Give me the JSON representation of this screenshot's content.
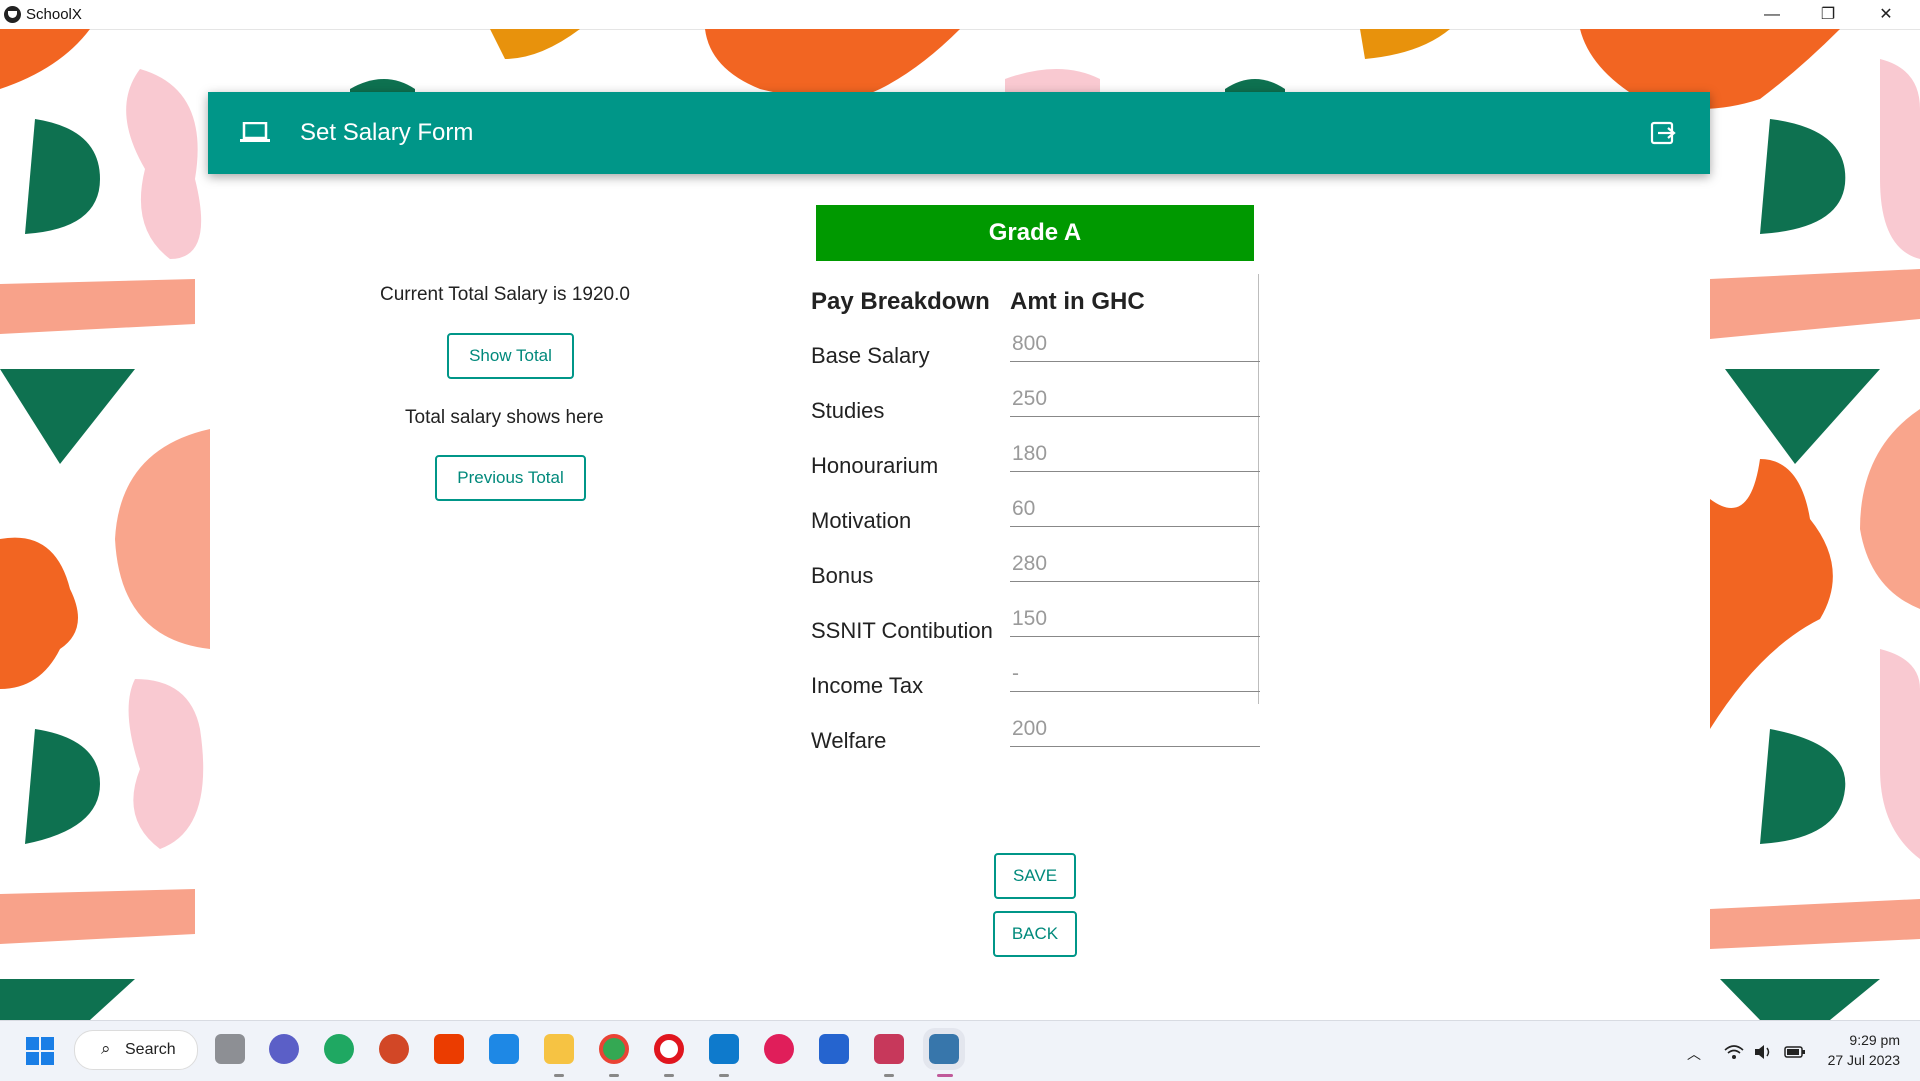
{
  "window": {
    "title": "SchoolX",
    "minimize": "—",
    "restore": "❐",
    "close": "✕"
  },
  "header": {
    "title": "Set Salary Form",
    "icon": "laptop-icon",
    "action_icon": "logout-icon"
  },
  "left": {
    "current_total_text": "Current Total Salary is 1920.0",
    "show_total_label": "Show Total",
    "total_placeholder_text": "Total salary shows here",
    "previous_total_label": "Previous Total"
  },
  "form": {
    "grade": "Grade A",
    "grade_color": "#009900",
    "col_breakdown": "Pay Breakdown",
    "col_amount": "Amt in GHC",
    "rows": [
      {
        "label": "Base Salary",
        "value": "800"
      },
      {
        "label": "Studies",
        "value": "250"
      },
      {
        "label": "Honourarium",
        "value": "180"
      },
      {
        "label": "Motivation",
        "value": "60"
      },
      {
        "label": "Bonus",
        "value": "280"
      },
      {
        "label": "SSNIT Contibution",
        "value": "150"
      },
      {
        "label": "Income Tax",
        "value": "-"
      },
      {
        "label": "Welfare",
        "value": "200"
      }
    ],
    "save_label": "SAVE",
    "back_label": "BACK"
  },
  "taskbar": {
    "search_label": "Search",
    "time": "9:29 pm",
    "date": "27 Jul 2023",
    "apps": [
      "windows-start-icon",
      "task-view-icon",
      "teams-icon",
      "edge-icon",
      "powerpoint-icon",
      "office-icon",
      "mail-icon",
      "file-explorer-icon",
      "chrome-icon",
      "opera-icon",
      "vscode-icon",
      "slack-icon",
      "todo-icon",
      "snipping-tool-icon",
      "python-icon"
    ]
  },
  "colors": {
    "accent": "#009688",
    "grade_bg": "#009900"
  }
}
